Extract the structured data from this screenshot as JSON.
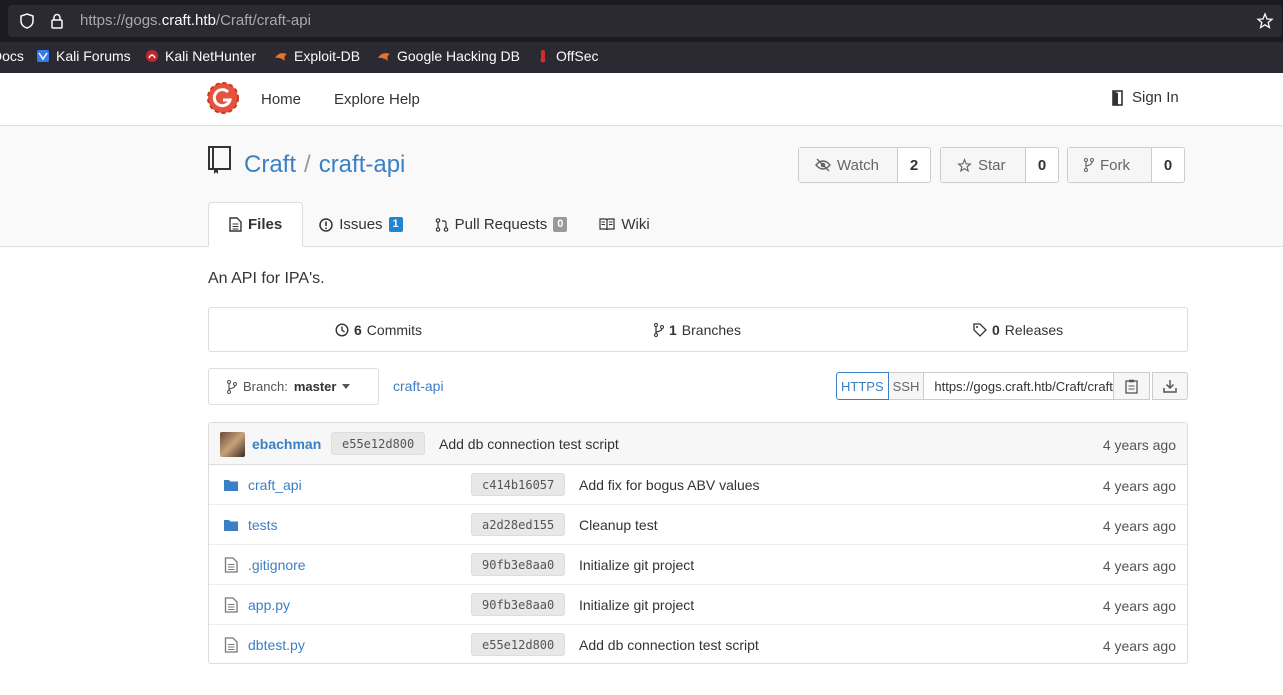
{
  "browser": {
    "url_prefix": "https://gogs.",
    "url_domain": "craft.htb",
    "url_suffix": "/Craft/craft-api",
    "bookmarks": [
      {
        "label": "Docs",
        "icon": "docs-icon"
      },
      {
        "label": "Kali Forums",
        "icon": "kali-forums-icon"
      },
      {
        "label": "Kali NetHunter",
        "icon": "nethunter-icon"
      },
      {
        "label": "Exploit-DB",
        "icon": "exploitdb-icon"
      },
      {
        "label": "Google Hacking DB",
        "icon": "ghdb-icon"
      },
      {
        "label": "OffSec",
        "icon": "offsec-icon"
      }
    ]
  },
  "nav": {
    "links": [
      "Home",
      "Explore",
      "Help"
    ],
    "signin": "Sign In"
  },
  "repo": {
    "owner": "Craft",
    "separator": "/",
    "name": "craft-api",
    "watch": {
      "label": "Watch",
      "count": "2"
    },
    "star": {
      "label": "Star",
      "count": "0"
    },
    "fork": {
      "label": "Fork",
      "count": "0"
    },
    "tabs": [
      {
        "label": "Files",
        "badge": null
      },
      {
        "label": "Issues",
        "badge": "1"
      },
      {
        "label": "Pull Requests",
        "badge": "0"
      },
      {
        "label": "Wiki",
        "badge": null
      }
    ],
    "description": "An API for IPA's.",
    "stats": {
      "commits_count": "6",
      "commits_label": "Commits",
      "branches_count": "1",
      "branches_label": "Branches",
      "releases_count": "0",
      "releases_label": "Releases"
    },
    "branch_prefix": "Branch:",
    "branch": "master",
    "path": "craft-api",
    "clone": {
      "https": "HTTPS",
      "ssh": "SSH",
      "url": "https://gogs.craft.htb/Craft/craft-api.git"
    },
    "latest_commit": {
      "author": "ebachman",
      "sha": "e55e12d800",
      "message": "Add db connection test script",
      "age": "4 years ago"
    },
    "files": [
      {
        "name": "craft_api",
        "type": "folder",
        "sha": "c414b16057",
        "message": "Add fix for bogus ABV values",
        "age": "4 years ago"
      },
      {
        "name": "tests",
        "type": "folder",
        "sha": "a2d28ed155",
        "message": "Cleanup test",
        "age": "4 years ago"
      },
      {
        "name": ".gitignore",
        "type": "file",
        "sha": "90fb3e8aa0",
        "message": "Initialize git project",
        "age": "4 years ago"
      },
      {
        "name": "app.py",
        "type": "file",
        "sha": "90fb3e8aa0",
        "message": "Initialize git project",
        "age": "4 years ago"
      },
      {
        "name": "dbtest.py",
        "type": "file",
        "sha": "e55e12d800",
        "message": "Add db connection test script",
        "age": "4 years ago"
      }
    ]
  },
  "colors": {
    "link": "#3b7fc4",
    "issues_badge": "#2185d0",
    "pr_badge": "#999999",
    "logo": "#e5533d"
  }
}
